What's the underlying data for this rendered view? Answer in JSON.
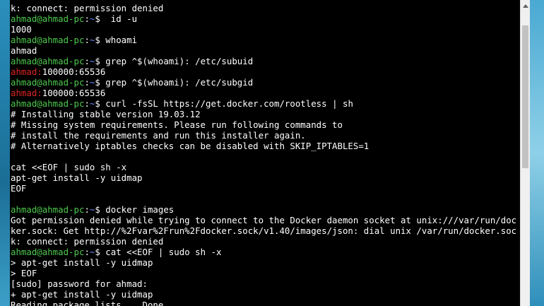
{
  "terminal": {
    "lines": [
      {
        "segments": [
          {
            "text": "k: connect: permission denied",
            "cls": ""
          }
        ]
      },
      {
        "segments": [
          {
            "text": "ahmad@ahmad-pc",
            "cls": "user"
          },
          {
            "text": ":",
            "cls": "colon"
          },
          {
            "text": "~",
            "cls": "path"
          },
          {
            "text": "$  id -u",
            "cls": ""
          }
        ]
      },
      {
        "segments": [
          {
            "text": "1000",
            "cls": ""
          }
        ]
      },
      {
        "segments": [
          {
            "text": "ahmad@ahmad-pc",
            "cls": "user"
          },
          {
            "text": ":",
            "cls": "colon"
          },
          {
            "text": "~",
            "cls": "path"
          },
          {
            "text": "$ whoami",
            "cls": ""
          }
        ]
      },
      {
        "segments": [
          {
            "text": "ahmad",
            "cls": ""
          }
        ]
      },
      {
        "segments": [
          {
            "text": "ahmad@ahmad-pc",
            "cls": "user"
          },
          {
            "text": ":",
            "cls": "colon"
          },
          {
            "text": "~",
            "cls": "path"
          },
          {
            "text": "$ grep ^$(whoami): /etc/subuid",
            "cls": ""
          }
        ]
      },
      {
        "segments": [
          {
            "text": "ahmad:",
            "cls": "err"
          },
          {
            "text": "100000:65536",
            "cls": ""
          }
        ]
      },
      {
        "segments": [
          {
            "text": "ahmad@ahmad-pc",
            "cls": "user"
          },
          {
            "text": ":",
            "cls": "colon"
          },
          {
            "text": "~",
            "cls": "path"
          },
          {
            "text": "$ grep ^$(whoami): /etc/subgid",
            "cls": ""
          }
        ]
      },
      {
        "segments": [
          {
            "text": "ahmad:",
            "cls": "err"
          },
          {
            "text": "100000:65536",
            "cls": ""
          }
        ]
      },
      {
        "segments": [
          {
            "text": "ahmad@ahmad-pc",
            "cls": "user"
          },
          {
            "text": ":",
            "cls": "colon"
          },
          {
            "text": "~",
            "cls": "path"
          },
          {
            "text": "$ curl -fsSL https://get.docker.com/rootless | sh",
            "cls": ""
          }
        ]
      },
      {
        "segments": [
          {
            "text": "# Installing stable version 19.03.12",
            "cls": ""
          }
        ]
      },
      {
        "segments": [
          {
            "text": "# Missing system requirements. Please run following commands to",
            "cls": ""
          }
        ]
      },
      {
        "segments": [
          {
            "text": "# install the requirements and run this installer again.",
            "cls": ""
          }
        ]
      },
      {
        "segments": [
          {
            "text": "# Alternatively iptables checks can be disabled with SKIP_IPTABLES=1",
            "cls": ""
          }
        ]
      },
      {
        "segments": [
          {
            "text": "",
            "cls": ""
          }
        ]
      },
      {
        "segments": [
          {
            "text": "cat <<EOF | sudo sh -x",
            "cls": ""
          }
        ]
      },
      {
        "segments": [
          {
            "text": "apt-get install -y uidmap",
            "cls": ""
          }
        ]
      },
      {
        "segments": [
          {
            "text": "EOF",
            "cls": ""
          }
        ]
      },
      {
        "segments": [
          {
            "text": "",
            "cls": ""
          }
        ]
      },
      {
        "segments": [
          {
            "text": "ahmad@ahmad-pc",
            "cls": "user"
          },
          {
            "text": ":",
            "cls": "colon"
          },
          {
            "text": "~",
            "cls": "path"
          },
          {
            "text": "$ docker images",
            "cls": ""
          }
        ]
      },
      {
        "segments": [
          {
            "text": "Got permission denied while trying to connect to the Docker daemon socket at unix:///var/run/doc",
            "cls": ""
          }
        ]
      },
      {
        "segments": [
          {
            "text": "ker.sock: Get http://%2Fvar%2Frun%2Fdocker.sock/v1.40/images/json: dial unix /var/run/docker.soc",
            "cls": ""
          }
        ]
      },
      {
        "segments": [
          {
            "text": "k: connect: permission denied",
            "cls": ""
          }
        ]
      },
      {
        "segments": [
          {
            "text": "ahmad@ahmad-pc",
            "cls": "user"
          },
          {
            "text": ":",
            "cls": "colon"
          },
          {
            "text": "~",
            "cls": "path"
          },
          {
            "text": "$ cat <<EOF | sudo sh -x",
            "cls": ""
          }
        ]
      },
      {
        "segments": [
          {
            "text": "> apt-get install -y uidmap",
            "cls": ""
          }
        ]
      },
      {
        "segments": [
          {
            "text": "> EOF",
            "cls": ""
          }
        ]
      },
      {
        "segments": [
          {
            "text": "[sudo] password for ahmad:",
            "cls": ""
          }
        ]
      },
      {
        "segments": [
          {
            "text": "+ apt-get install -y uidmap",
            "cls": ""
          }
        ]
      },
      {
        "segments": [
          {
            "text": "Reading package lists... Done",
            "cls": ""
          }
        ]
      }
    ]
  },
  "colors": {
    "background": "#000000",
    "text": "#ffffff",
    "prompt_user": "#4ec94e",
    "prompt_path": "#6b8cff",
    "error_user": "#e02424"
  }
}
